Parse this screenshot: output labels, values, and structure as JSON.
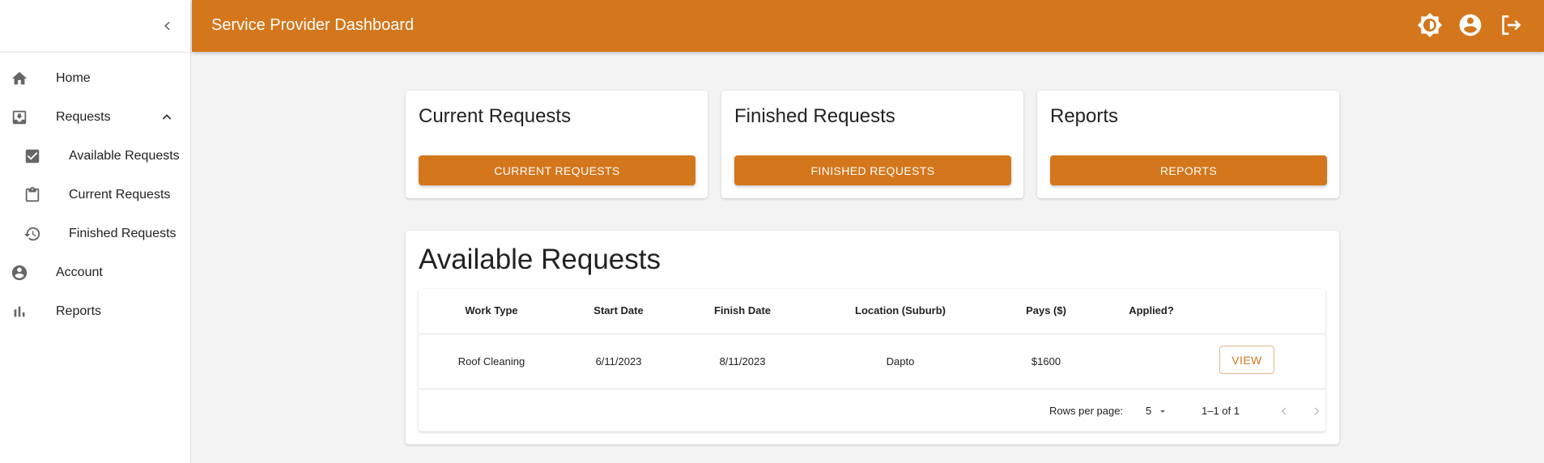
{
  "appbar": {
    "title": "Service Provider Dashboard"
  },
  "icons": {
    "collapse": "chevron-left-icon",
    "theme": "brightness-icon",
    "account": "account-circle-icon",
    "logout": "logout-icon"
  },
  "sidebar": {
    "items": [
      {
        "label": "Home",
        "icon": "home-icon"
      },
      {
        "label": "Requests",
        "icon": "inbox-icon"
      },
      {
        "label": "Available Requests",
        "icon": "checkbox-icon"
      },
      {
        "label": "Current Requests",
        "icon": "clipboard-icon"
      },
      {
        "label": "Finished Requests",
        "icon": "history-icon"
      },
      {
        "label": "Account",
        "icon": "account-circle-icon"
      },
      {
        "label": "Reports",
        "icon": "bar-chart-icon"
      }
    ]
  },
  "cards": [
    {
      "title": "Current Requests",
      "button": "CURRENT REQUESTS"
    },
    {
      "title": "Finished Requests",
      "button": "FINISHED REQUESTS"
    },
    {
      "title": "Reports",
      "button": "REPORTS"
    }
  ],
  "available": {
    "title": "Available Requests",
    "columns": [
      "Work Type",
      "Start Date",
      "Finish Date",
      "Location (Suburb)",
      "Pays ($)",
      "Applied?"
    ],
    "rows": [
      {
        "work_type": "Roof Cleaning",
        "start": "6/11/2023",
        "finish": "8/11/2023",
        "location": "Dapto",
        "pays": "$1600",
        "applied": "",
        "action": "VIEW"
      }
    ],
    "pagination": {
      "rows_per_page_label": "Rows per page:",
      "rows_per_page": "5",
      "range": "1–1 of 1"
    }
  },
  "colors": {
    "accent": "#d4761b",
    "background": "#f3f3f3"
  }
}
